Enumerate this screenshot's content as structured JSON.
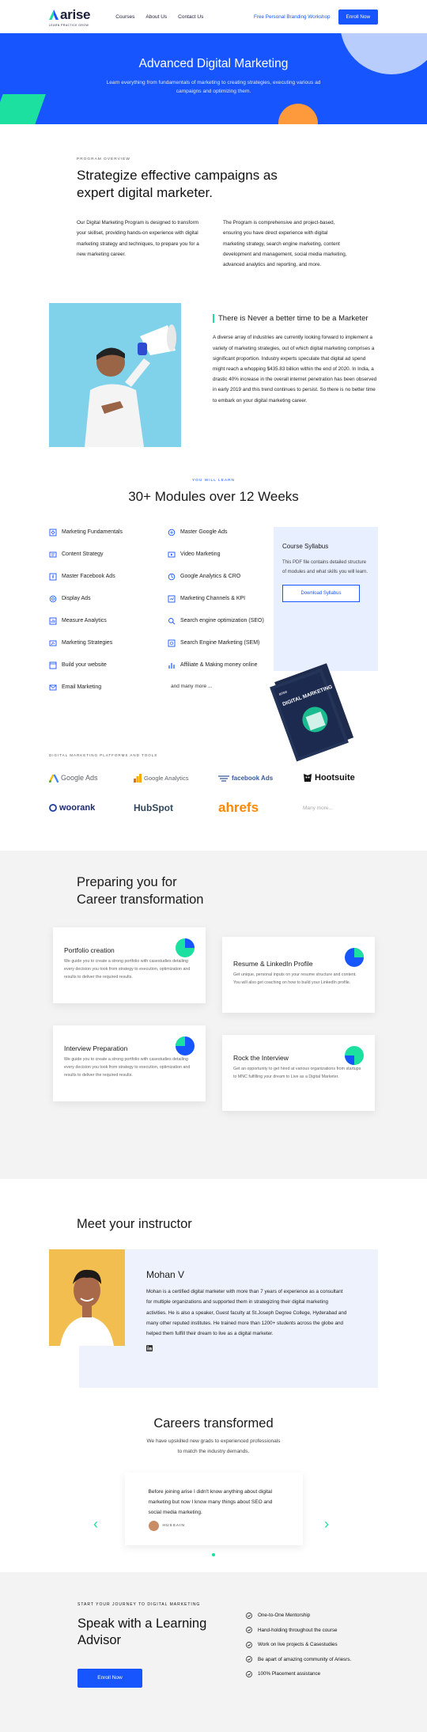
{
  "header": {
    "logo_text": "arise",
    "logo_tagline": "LEARN PRACTICE GROW",
    "nav": [
      "Courses",
      "About Us",
      "Contact Us"
    ],
    "workshop_link": "Free Personal Branding Workshop",
    "enroll": "Enroll Now"
  },
  "hero": {
    "title": "Advanced Digital Marketing",
    "subtitle": "Learn everything from fundamentals of marketing to creating strategies, executing various ad campaigns and optimizing them."
  },
  "overview": {
    "eyebrow": "PROGRAM OVERVIEW",
    "title": "Strategize effective campaigns as expert digital marketer.",
    "col1": "Our Digital Marketing Program is designed to transform your skillset, providing hands-on experience with digital marketing strategy and techniques, to prepare you for a new marketing career.",
    "col2": "The Program is comprehensive and project-based, ensuring you have direct experience with digital marketing strategy, search engine marketing, content development and management, social media marketing, advanced analytics and reporting, and more."
  },
  "better": {
    "title": "There is Never a better time to be a Marketer",
    "text": "A diverse array of industries are currently looking forward to implement a variety of marketing strategies, out of which digital marketing comprises a significant proportion. Industry experts speculate that digital ad spend might reach a whopping $435.83 billion within the end of 2020. In India, a drastic 40% increase in the overall internet penetration has been observed in early 2019 and this trend continues to persist. So there is no better time to embark on your digital marketing career."
  },
  "modules": {
    "eyebrow": "YOU WILL LEARN",
    "title": "30+ Modules over 12 Weeks",
    "col1": [
      "Marketing Fundamentals",
      "Content Strategy",
      "Master Facebook Ads",
      "Display Ads",
      "Measure Analytics",
      "Marketing Strategies",
      "Build your website",
      "Email Marketing"
    ],
    "col2": [
      "Master Google Ads",
      "Video Marketing",
      "Google Analytics & CRO",
      "Marketing Channels & KPI",
      "Search engine optimization (SEO)",
      "Search Engine Marketing (SEM)",
      "Affiliate & Making money online"
    ],
    "more": "and many more ..."
  },
  "syllabus": {
    "title": "Course Syllabus",
    "text": "This PDF file contains detailed structure of modules and what skills you will learn.",
    "button": "Download Syllabus",
    "book_small": "arise",
    "book_title": "DIGITAL MARKETING"
  },
  "tools": {
    "eyebrow": "DIGITAL MARKETING PLATFORMS AND TOOLS",
    "items": [
      "Google Ads",
      "Google Analytics",
      "facebook Ads",
      "Hootsuite",
      "woorank",
      "HubSpot",
      "ahrefs",
      "Many more..."
    ]
  },
  "career": {
    "title_line1": "Preparing you for",
    "title_line2": "Career transformation",
    "cards": [
      {
        "title": "Portfolio creation",
        "text": "We guide you to create a strong portfolio with casestudies detailing every decision you took from strategy to execution, optimization and results to deliver the required results."
      },
      {
        "title": "Resume & LinkedIn Profile",
        "text": "Get unique, personal inputs on your resume structure and content. You will also get coaching on how to build your LinkedIn profile."
      },
      {
        "title": "Interview Preparation",
        "text": "We guide you to create a strong portfolio with casestudies detailing every decision you took from strategy to execution, optimization and results to deliver the required results."
      },
      {
        "title": "Rock the Interview",
        "text": "Get an opportunity to get hired at various organizations from startups to MNC fulfilling your dream to Live as a Digital Marketer."
      }
    ]
  },
  "instructor": {
    "heading": "Meet your instructor",
    "name": "Mohan V",
    "bio": "Mohan is a certified digital marketer with more than 7 years of experience as a consultant for multiple organizations and supported them in strategizing their digital marketing activities. He is also a speaker, Guest faculty at St.Joseph Degree College, Hyderabad and many other reputed institutes. He trained more than 1200+ students across the globe and helped them fulfill their dream to live as a digital marketer."
  },
  "testimonials": {
    "title": "Careers transformed",
    "subtitle": "We have upskilled new grads to experienced professionals to match the industry demands.",
    "quote": "Before joining arise I didn't know anything about digital marketing but now I know many things about SEO and social media marketing.",
    "author": "HUSSAIN"
  },
  "cta": {
    "eyebrow": "START YOUR JOURNEY TO DIGITAL MARKETING",
    "title": "Speak with a Learning Advisor",
    "button": "Enroll Now",
    "checks": [
      "One-to-One Mentorship",
      "Hand-holding throughout the course",
      "Work on live projects & Casestudies",
      "Be apart of amazing community of Ariesrs.",
      "100% Placement assistance"
    ]
  },
  "colors": {
    "primary": "#1655ff",
    "accent_green": "#1be0a0",
    "accent_orange": "#ff9a3c"
  }
}
